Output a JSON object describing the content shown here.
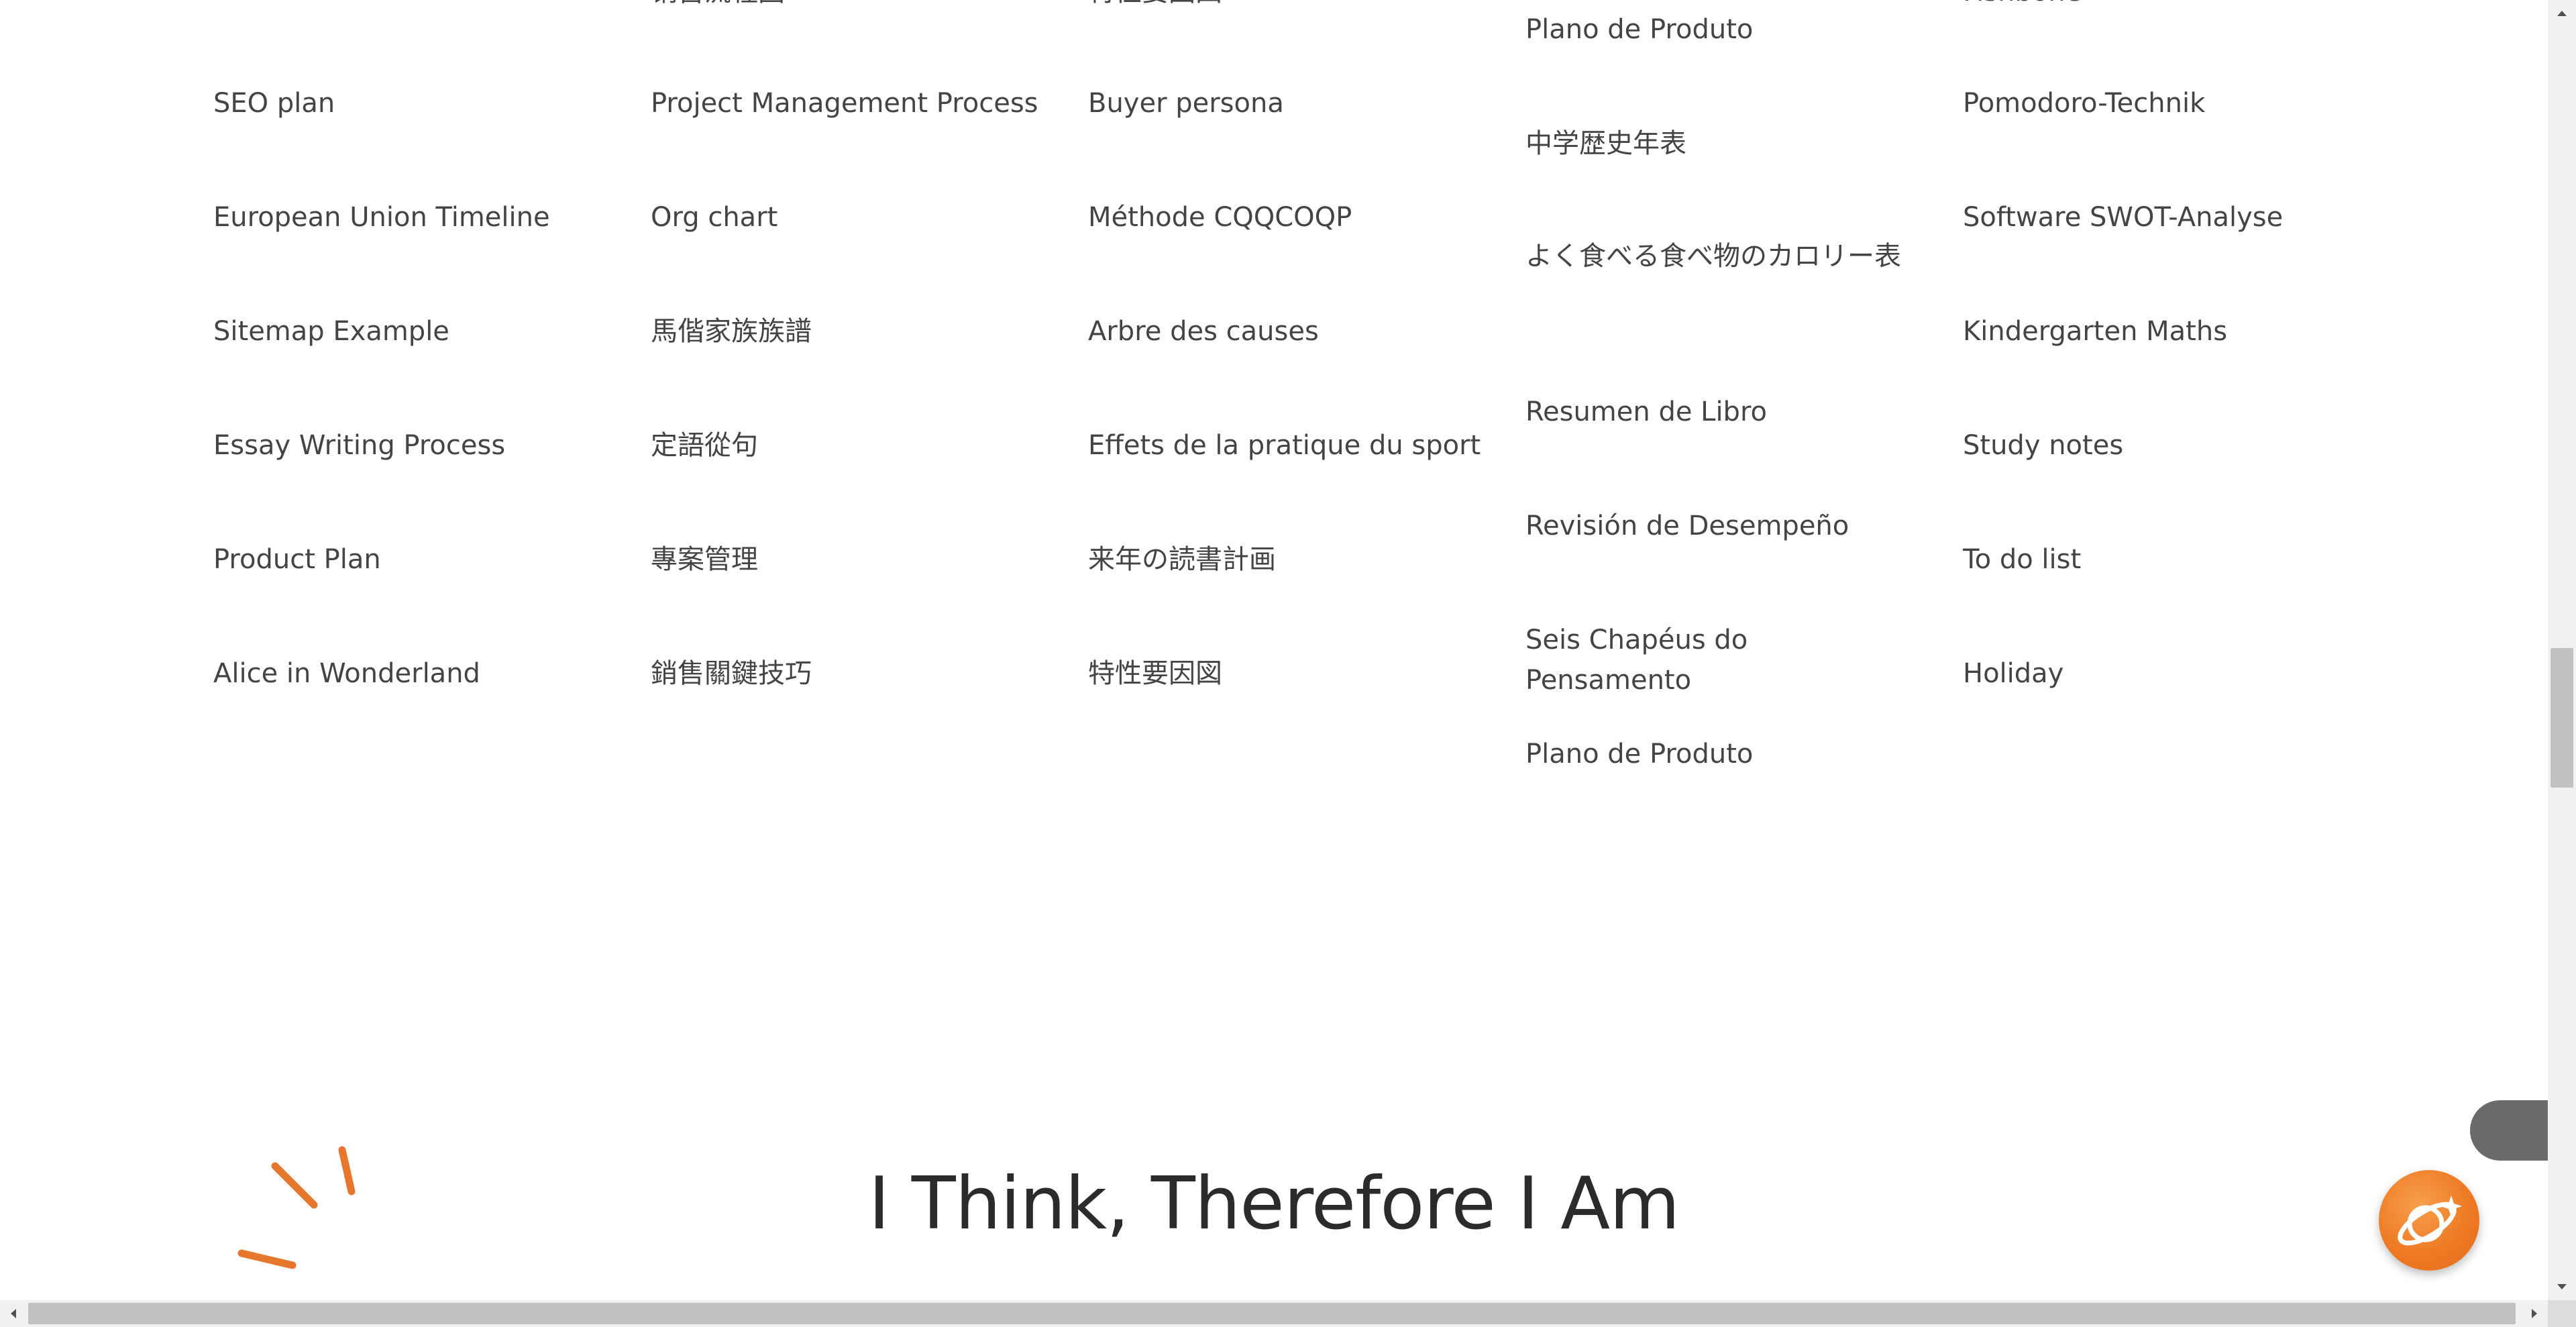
{
  "columns": [
    {
      "top_cut": "",
      "items": [
        "SEO plan",
        "European Union Timeline",
        "Sitemap Example",
        "Essay Writing Process",
        "Product Plan",
        "Alice in Wonderland"
      ]
    },
    {
      "top_cut": "销售流程图",
      "items": [
        "Project Management Process",
        "Org chart",
        "馬偕家族族譜",
        "定語從句",
        "專案管理",
        "銷售關鍵技巧"
      ]
    },
    {
      "top_cut": "特性要因図",
      "items": [
        "Buyer persona",
        "Méthode CQQCOQP",
        "Arbre des causes",
        "Effets de la pratique du sport",
        "来年の読書計画",
        "特性要因図"
      ]
    },
    {
      "top_cut": "",
      "items": [
        "Plano de Produto",
        "中学歴史年表",
        "よく食べる食べ物のカロリー表",
        "Resumen de Libro",
        "Revisión de Desempeño",
        "Seis Chapéus do Pensamento",
        "Plano de Produto"
      ]
    },
    {
      "top_cut": "Fishbone",
      "items": [
        "Pomodoro-Technik",
        "Software SWOT-Analyse",
        "Kindergarten Maths",
        "Study notes",
        "To do list",
        "Holiday"
      ]
    }
  ],
  "headline": "I Think, Therefore I Am",
  "icons": {
    "fab": "planet-sparkle-icon",
    "decoration": "sparkle-lines-icon"
  },
  "colors": {
    "accent": "#E8772E",
    "text": "#444444",
    "headline": "#2B2B2B",
    "side_tab": "#6A6A6A"
  }
}
